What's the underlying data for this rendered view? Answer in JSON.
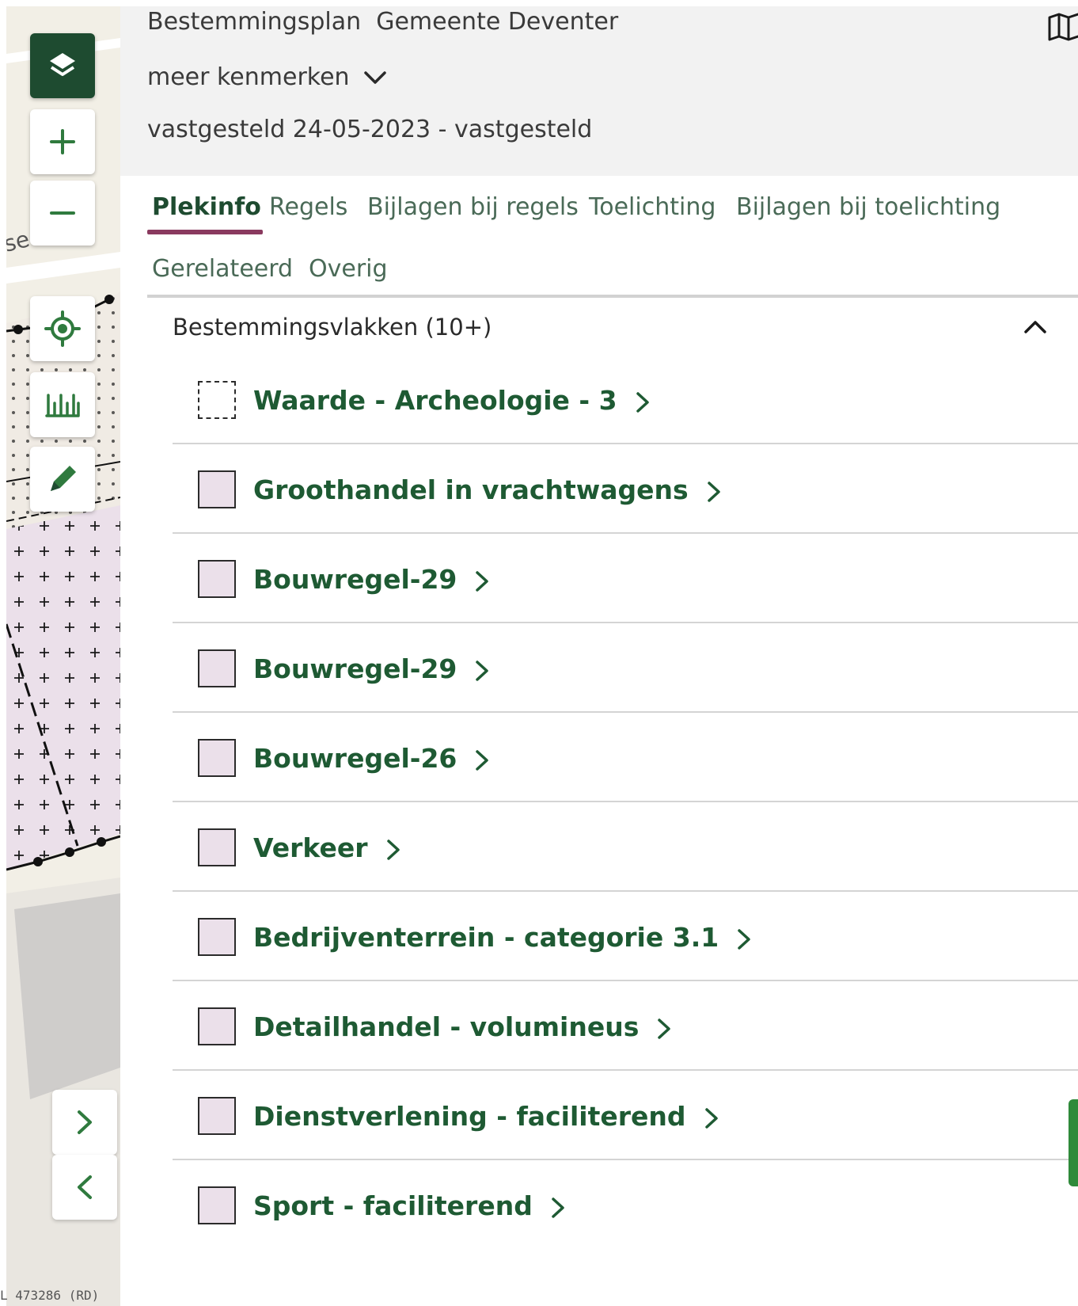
{
  "map": {
    "zoom_in_label": "+",
    "zoom_out_label": "−",
    "coordinate_text": "L 473286 (RD)",
    "street_fragment": "se",
    "colors": {
      "background": "#f2efe6",
      "plan_area": "#ebe0ea",
      "control_dark": "#1e4b30",
      "control_icon": "#2f7a3e"
    },
    "icons": [
      "layers-icon",
      "plus-icon",
      "minus-icon",
      "locate-icon",
      "measure-icon",
      "pencil-icon",
      "chevron-right-icon",
      "chevron-left-icon"
    ]
  },
  "header": {
    "plan_type": "Bestemmingsplan",
    "municipality": "Gemeente Deventer",
    "more_features": "meer kenmerken",
    "status": "vastgesteld 24-05-2023 - vastgesteld"
  },
  "tabs": [
    {
      "label": "Plekinfo",
      "active": true
    },
    {
      "label": "Regels",
      "active": false
    },
    {
      "label": "Bijlagen bij regels",
      "active": false
    },
    {
      "label": "Toelichting",
      "active": false
    },
    {
      "label": "Bijlagen bij toelichting",
      "active": false
    },
    {
      "label": "Gerelateerd",
      "active": false
    },
    {
      "label": "Overig",
      "active": false
    }
  ],
  "section": {
    "title": "Bestemmingsvlakken (10+)",
    "expanded": true
  },
  "items": [
    {
      "label": "Waarde - Archeologie - 3",
      "swatch": "dashed"
    },
    {
      "label": "Groothandel in vrachtwagens",
      "swatch": "fill"
    },
    {
      "label": "Bouwregel-29",
      "swatch": "fill"
    },
    {
      "label": "Bouwregel-29",
      "swatch": "fill"
    },
    {
      "label": "Bouwregel-26",
      "swatch": "fill"
    },
    {
      "label": "Verkeer",
      "swatch": "fill"
    },
    {
      "label": "Bedrijventerrein - categorie 3.1",
      "swatch": "fill"
    },
    {
      "label": "Detailhandel - volumineus",
      "swatch": "fill"
    },
    {
      "label": "Dienstverlening - faciliterend",
      "swatch": "fill"
    },
    {
      "label": "Sport - faciliterend",
      "swatch": "fill"
    }
  ],
  "colors": {
    "accent_green": "#1e5a33",
    "tab_underline": "#8a3a5f",
    "header_bg": "#f2f2f2"
  }
}
